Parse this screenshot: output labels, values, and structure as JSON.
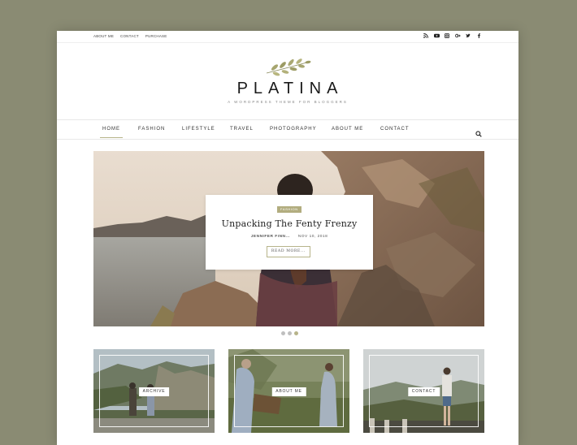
{
  "topbar": {
    "links": [
      "ABOUT ME",
      "CONTACT",
      "PURCHASE"
    ],
    "social_icons": [
      "rss-icon",
      "youtube-icon",
      "instagram-icon",
      "google-plus-icon",
      "twitter-icon",
      "facebook-icon"
    ]
  },
  "header": {
    "logo": "PLATINA",
    "tagline": "A WordPress Theme for Bloggers"
  },
  "nav": {
    "items": [
      "HOME",
      "FASHION",
      "LIFESTYLE",
      "TRAVEL",
      "PHOTOGRAPHY",
      "ABOUT ME",
      "CONTACT"
    ],
    "active_index": 0
  },
  "hero": {
    "category": "FASHION",
    "title": "Unpacking The Fenty Frenzy",
    "author": "JENNIFER FINN...",
    "date": "NOV 10, 2018",
    "read_more": "READ MORE..."
  },
  "slider": {
    "slide_count": 3
  },
  "promos": [
    {
      "label": "ARCHIVE"
    },
    {
      "label": "ABOUT ME"
    },
    {
      "label": "CONTACT"
    }
  ],
  "colors": {
    "background": "#8a8b73",
    "accent": "#b2ad7f"
  }
}
